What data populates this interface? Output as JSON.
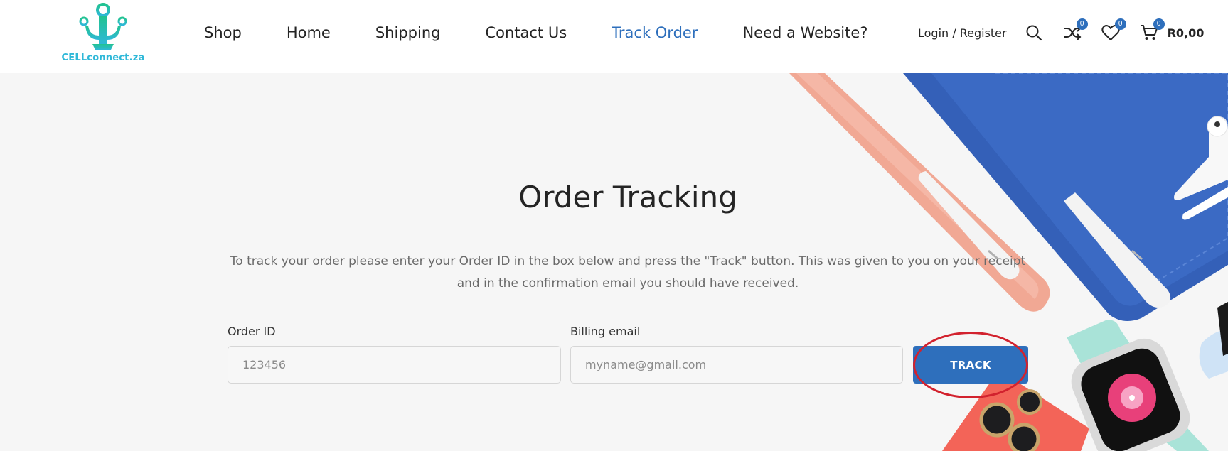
{
  "brand": {
    "logo_text": "CELLconnect.za"
  },
  "nav": {
    "items": [
      {
        "label": "Shop"
      },
      {
        "label": "Home"
      },
      {
        "label": "Shipping"
      },
      {
        "label": "Contact Us"
      },
      {
        "label": "Track Order",
        "active": true
      },
      {
        "label": "Need a Website?"
      }
    ]
  },
  "header_tools": {
    "login_label": "Login / Register",
    "compare_count": "0",
    "wishlist_count": "0",
    "cart_count": "0",
    "cart_total": "R0,00",
    "icons": [
      "search-icon",
      "compare-icon",
      "heart-icon",
      "cart-icon"
    ]
  },
  "main": {
    "title": "Order Tracking",
    "description": "To track your order please enter your Order ID in the box below and press the \"Track\" button. This was given to you on your receipt and in the confirmation email you should have received.",
    "order_id": {
      "label": "Order ID",
      "placeholder": "123456",
      "value": ""
    },
    "billing_email": {
      "label": "Billing email",
      "placeholder": "myname@gmail.com",
      "value": ""
    },
    "track_button_label": "TRACK"
  },
  "colors": {
    "accent": "#2e6fbc",
    "annotation": "#d2222e",
    "logo_green": "#22c38f",
    "logo_cyan": "#2fb8d8"
  }
}
